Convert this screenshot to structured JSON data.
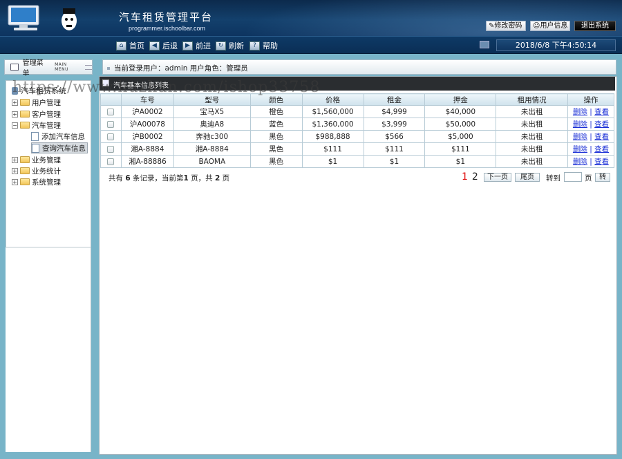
{
  "header": {
    "title": "汽车租赁管理平台",
    "subtitle": "programmer.ischoolbar.com",
    "buttons": {
      "change_password": "修改密码",
      "user_info": "用户信息",
      "logout": "退出系统"
    }
  },
  "nav": {
    "home": "首页",
    "back": "后退",
    "forward": "前进",
    "refresh": "刷新",
    "help": "帮助",
    "datetime": "2018/6/8 下午4:50:14"
  },
  "sidebar": {
    "title": "管理菜单",
    "subtitle": "MAIN MENU",
    "root": "汽车租赁系统",
    "items": [
      {
        "label": "用户管理",
        "expander": "+"
      },
      {
        "label": "客户管理",
        "expander": "+"
      },
      {
        "label": "汽车管理",
        "expander": "−",
        "children": [
          {
            "label": "添加汽车信息"
          },
          {
            "label": "查询汽车信息"
          }
        ]
      },
      {
        "label": "业务管理",
        "expander": "+"
      },
      {
        "label": "业务统计",
        "expander": "+"
      },
      {
        "label": "系统管理",
        "expander": "+"
      }
    ]
  },
  "main": {
    "login_info": "当前登录用户：admin  用户角色：管理员",
    "list_title": "汽车基本信息列表",
    "columns": [
      "",
      "车号",
      "型号",
      "颜色",
      "价格",
      "租金",
      "押金",
      "租用情况",
      "操作"
    ],
    "rows": [
      {
        "plate": "沪A0002",
        "model": "宝马X5",
        "color": "橙色",
        "price": "$1,560,000",
        "rent": "$4,999",
        "deposit": "$40,000",
        "status": "未出租"
      },
      {
        "plate": "沪A00078",
        "model": "奥迪A8",
        "color": "蓝色",
        "price": "$1,360,000",
        "rent": "$3,999",
        "deposit": "$50,000",
        "status": "未出租"
      },
      {
        "plate": "沪B0002",
        "model": "奔驰c300",
        "color": "黑色",
        "price": "$988,888",
        "rent": "$566",
        "deposit": "$5,000",
        "status": "未出租"
      },
      {
        "plate": "湘A-8884",
        "model": "湘A-8884",
        "color": "黑色",
        "price": "$111",
        "rent": "$111",
        "deposit": "$111",
        "status": "未出租"
      },
      {
        "plate": "湘A-88886",
        "model": "BAOMA",
        "color": "黑色",
        "price": "$1",
        "rent": "$1",
        "deposit": "$1",
        "status": "未出租"
      }
    ],
    "actions": {
      "delete": "删除",
      "separator": "|",
      "view": "查看"
    },
    "pager": {
      "prefix": "共有",
      "total": "6",
      "mid": "条记录，当前第",
      "current": "1",
      "mid2": "页，共",
      "pages": "2",
      "suffix": "页",
      "page_links": [
        "1",
        "2"
      ],
      "next": "下一页",
      "last": "尾页",
      "goto": "转到",
      "unit": "页",
      "go": "转"
    }
  },
  "watermark": "https://www.huzhan.com/ishop33758",
  "colors": {
    "header_bg": "#13406c",
    "panel_bg": "#78b4c8",
    "link": "#1a2fd6",
    "current_page": "#e01010"
  }
}
